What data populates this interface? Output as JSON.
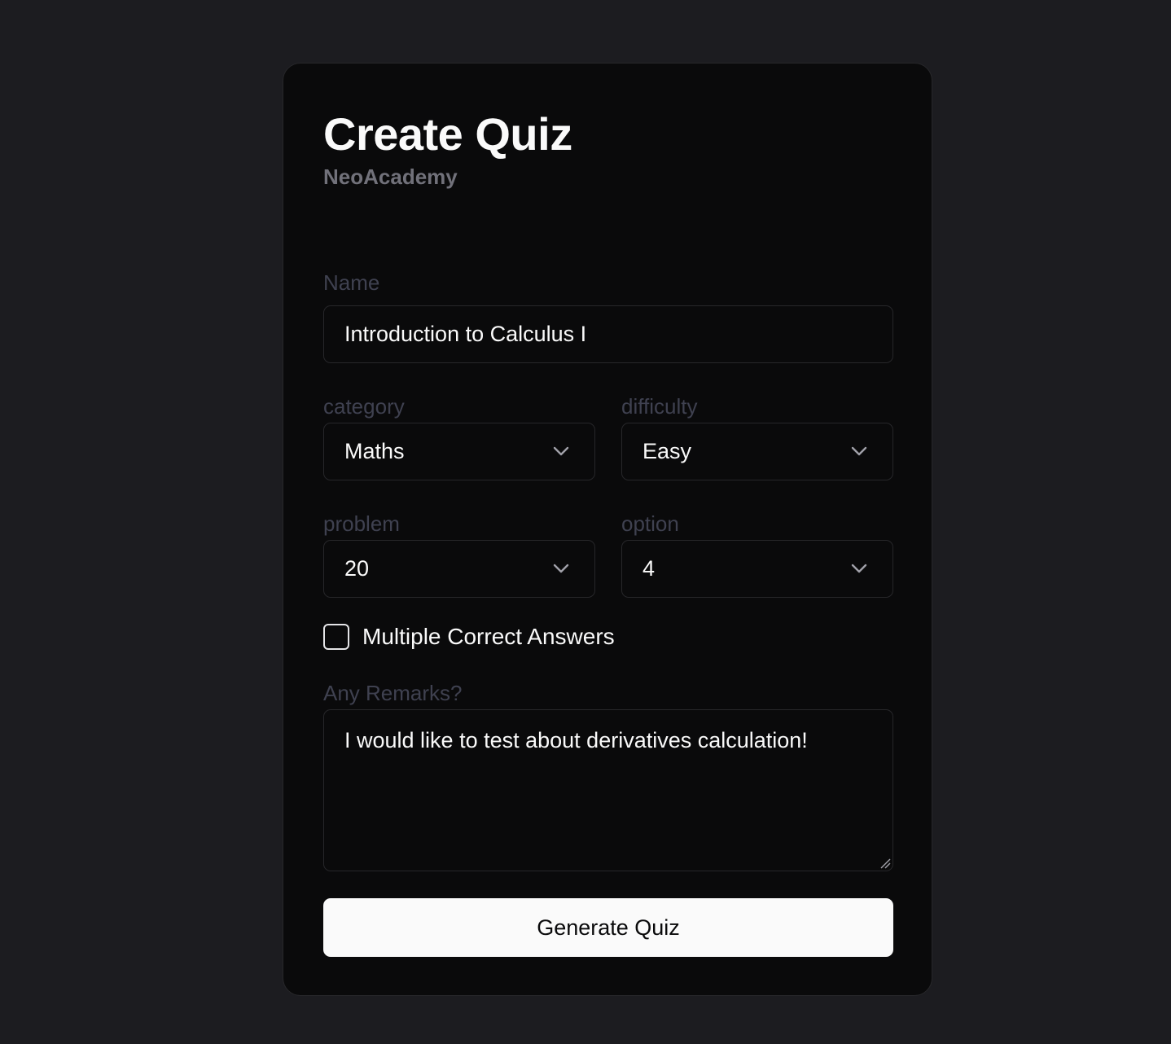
{
  "header": {
    "title": "Create Quiz",
    "subtitle": "NeoAcademy"
  },
  "form": {
    "name": {
      "label": "Name",
      "value": "Introduction to Calculus I"
    },
    "category": {
      "label": "category",
      "value": "Maths"
    },
    "difficulty": {
      "label": "difficulty",
      "value": "Easy"
    },
    "problem": {
      "label": "problem",
      "value": "20"
    },
    "option": {
      "label": "option",
      "value": "4"
    },
    "multiple_correct": {
      "label": "Multiple Correct Answers",
      "checked": false
    },
    "remarks": {
      "label": "Any Remarks?",
      "value": "I would like to test about derivatives calculation!"
    },
    "submit_label": "Generate Quiz"
  },
  "colors": {
    "page_bg": "#1c1c20",
    "card_bg": "#0a0a0b",
    "border": "#27272a",
    "label": "#3f4150",
    "button_bg": "#fafafa"
  },
  "icons": {
    "select_arrow": "chevron-down-icon",
    "resize_handle": "resize-handle-icon"
  }
}
